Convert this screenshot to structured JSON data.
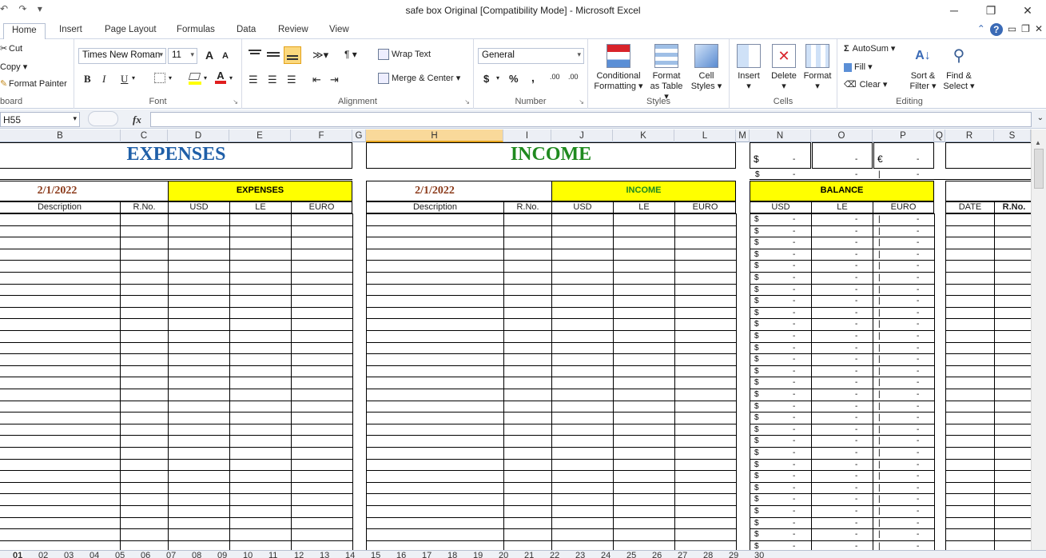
{
  "window": {
    "title": "safe box Original  [Compatibility Mode]  -  Microsoft Excel",
    "minimize": "─",
    "restore": "❐",
    "close": "✕"
  },
  "qat": {
    "save": "↶",
    "undo": "↷",
    "customize": "▾"
  },
  "ribbon_tabs": [
    "Home",
    "Insert",
    "Page Layout",
    "Formulas",
    "Data",
    "Review",
    "View"
  ],
  "clipboard": {
    "cut": "Cut",
    "copy": "Copy",
    "format_painter": "Format Painter",
    "label": "board"
  },
  "font": {
    "name": "Times New Roman",
    "size": "11",
    "bold": "B",
    "italic": "I",
    "underline": "U",
    "grow": "A",
    "shrink": "A",
    "label": "Font"
  },
  "alignment": {
    "wrap_text": "Wrap Text",
    "merge_center": "Merge & Center",
    "label": "Alignment"
  },
  "number": {
    "format": "General",
    "currency": "$",
    "percent": "%",
    "comma": ",",
    "inc_decimal": ".00",
    "dec_decimal": ".00",
    "label": "Number"
  },
  "styles": {
    "conditional_1": "Conditional",
    "conditional_2": "Formatting",
    "format_table_1": "Format",
    "format_table_2": "as Table",
    "cell_styles_1": "Cell",
    "cell_styles_2": "Styles",
    "label": "Styles"
  },
  "cells": {
    "insert": "Insert",
    "delete": "Delete",
    "format": "Format",
    "label": "Cells"
  },
  "editing": {
    "autosum": "AutoSum",
    "fill": "Fill",
    "clear": "Clear",
    "sort_1": "Sort &",
    "sort_2": "Filter",
    "find_1": "Find &",
    "find_2": "Select",
    "label": "Editing"
  },
  "formula_bar": {
    "name_box": "H55",
    "fx": "fx",
    "value": ""
  },
  "columns": [
    "B",
    "C",
    "D",
    "E",
    "F",
    "G",
    "H",
    "I",
    "J",
    "K",
    "L",
    "M",
    "N",
    "O",
    "P",
    "Q",
    "R",
    "S"
  ],
  "selected_column": "H",
  "sheet": {
    "expenses_title": "EXPENSES",
    "income_title": "INCOME",
    "expenses_date": "2/1/2022",
    "income_date": "2/1/2022",
    "expenses_header": "EXPENSES",
    "income_header": "INCOME",
    "balance_header": "BALANCE",
    "exp_cols": [
      "Description",
      "R.No.",
      "USD",
      "LE",
      "EURO"
    ],
    "inc_cols": [
      "Description",
      "R.No.",
      "USD",
      "LE",
      "EURO"
    ],
    "bal_cols": [
      "USD",
      "LE",
      "EURO"
    ],
    "right_cols": [
      "DATE",
      "R.No."
    ],
    "top_usd": "$",
    "top_dash": "-",
    "top_euro": "€",
    "row2_usd": "$",
    "dash": "-",
    "dollar": "$",
    "pipe": "|"
  },
  "sheet_tabs": [
    "01",
    "02",
    "03",
    "04",
    "05",
    "06",
    "07",
    "08",
    "09",
    "10",
    "11",
    "12",
    "13",
    "14",
    "15",
    "16",
    "17",
    "18",
    "19",
    "20",
    "21",
    "22",
    "23",
    "24",
    "25",
    "26",
    "27",
    "28",
    "29",
    "30"
  ]
}
